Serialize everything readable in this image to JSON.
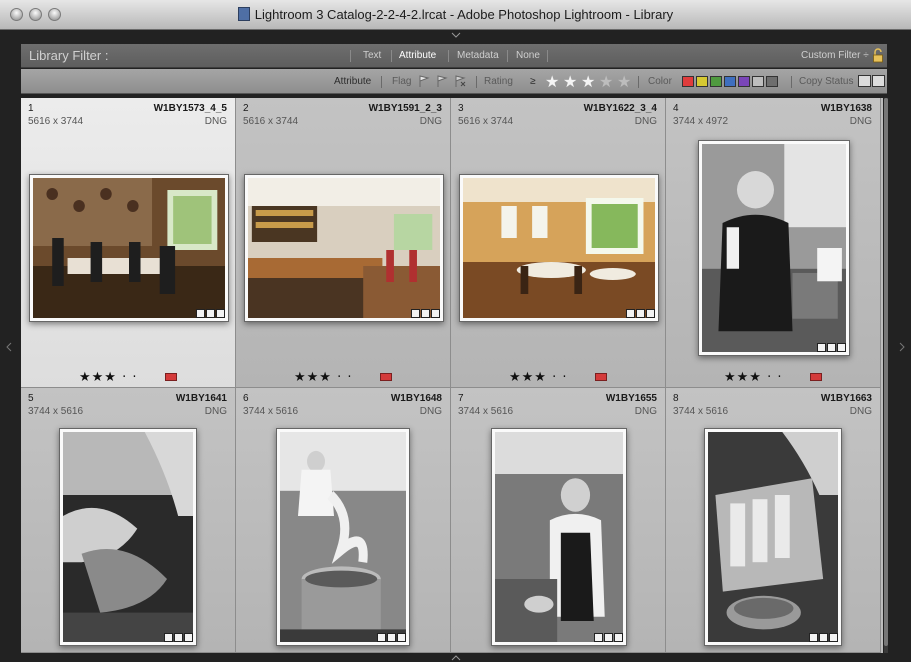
{
  "window": {
    "title": "Lightroom 3 Catalog-2-2-4-2.lrcat - Adobe Photoshop Lightroom - Library"
  },
  "filter_bar": {
    "title": "Library Filter :",
    "tabs": [
      "Text",
      "Attribute",
      "Metadata",
      "None"
    ],
    "active_tab": "Attribute",
    "preset": "Custom Filter ÷"
  },
  "attribute_bar": {
    "attribute_label": "Attribute",
    "flag_label": "Flag",
    "rating_label": "Rating",
    "rating_operator": "≥",
    "rating_stars": 3,
    "rating_max": 5,
    "color_label": "Color",
    "colors": [
      "#e03c3c",
      "#d6c932",
      "#4f9a3f",
      "#3f6fbf",
      "#7a45b8",
      "#bdbdbd",
      "#6e6e6e"
    ],
    "copy_status_label": "Copy Status"
  },
  "photos": [
    {
      "index": "1",
      "name": "W1BY1573_4_5",
      "dims": "5616 x 3744",
      "format": "DNG",
      "stars": "★★★ · ·",
      "label_color": "red",
      "selected": true,
      "scene": "dining-room-wallpaper"
    },
    {
      "index": "2",
      "name": "W1BY1591_2_3",
      "dims": "5616 x 3744",
      "format": "DNG",
      "stars": "★★★ · ·",
      "label_color": "red",
      "selected": false,
      "scene": "bar-interior"
    },
    {
      "index": "3",
      "name": "W1BY1622_3_4",
      "dims": "5616 x 3744",
      "format": "DNG",
      "stars": "★★★ · ·",
      "label_color": "red",
      "selected": false,
      "scene": "restaurant-dining"
    },
    {
      "index": "4",
      "name": "W1BY1638",
      "dims": "3744 x 4972",
      "format": "DNG",
      "stars": "★★★ · ·",
      "label_color": "red",
      "selected": false,
      "scene": "chef-bw"
    },
    {
      "index": "5",
      "name": "W1BY1641",
      "dims": "3744 x 5616",
      "format": "DNG",
      "stars": "",
      "label_color": "",
      "selected": false,
      "scene": "hands-meat-bw"
    },
    {
      "index": "6",
      "name": "W1BY1648",
      "dims": "3744 x 5616",
      "format": "DNG",
      "stars": "",
      "label_color": "",
      "selected": false,
      "scene": "steaming-pot-bw"
    },
    {
      "index": "7",
      "name": "W1BY1655",
      "dims": "3744 x 5616",
      "format": "DNG",
      "stars": "",
      "label_color": "",
      "selected": false,
      "scene": "young-chef-bw"
    },
    {
      "index": "8",
      "name": "W1BY1663",
      "dims": "3744 x 5616",
      "format": "DNG",
      "stars": "",
      "label_color": "",
      "selected": false,
      "scene": "tray-pot-bw"
    }
  ]
}
